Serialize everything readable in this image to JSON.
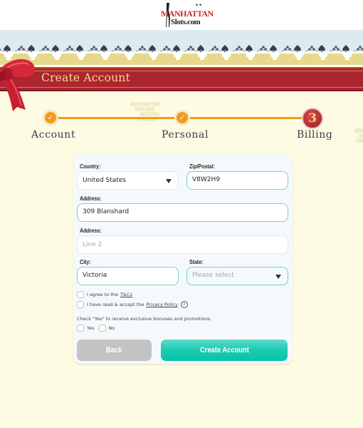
{
  "logo": {
    "line1": "MANHATTAN",
    "line2": "Slots.com"
  },
  "banner": {
    "title": "Create Account",
    "decoration": "ribbon-bow-icon"
  },
  "stepper": {
    "steps": [
      {
        "label": "Account",
        "status": "completed",
        "icon": "check-icon"
      },
      {
        "label": "Personal",
        "status": "completed",
        "icon": "check-icon"
      },
      {
        "label": "Billing",
        "status": "current",
        "number": "3"
      }
    ],
    "accent_color": "#f39a1c",
    "current_color": "#ac2530"
  },
  "form": {
    "country": {
      "label": "Country:",
      "value": "United States"
    },
    "zip": {
      "label": "Zip/Postal:",
      "value": "V8W2H9"
    },
    "address1": {
      "label": "Address:",
      "value": "309 Blanshard"
    },
    "address2": {
      "label": "Address:",
      "placeholder": "Line 2"
    },
    "city": {
      "label": "City:",
      "value": "Victoria"
    },
    "state": {
      "label": "State:",
      "placeholder": "Please select"
    },
    "terms": {
      "text": "I agree to the",
      "link": "T&Cs",
      "checked": false
    },
    "privacy": {
      "text": "I have read & accept the",
      "link": "Privacy Policy",
      "help": "?",
      "checked": false
    },
    "promo": {
      "text": "Check \"Yes\" to receive exclusive bonuses and promotions",
      "yes": "Yes",
      "no": "No"
    },
    "buttons": {
      "back": "Back",
      "create": "Create Account"
    },
    "active_border_color": "#6fd6c6",
    "primary_color": "#03c4a8"
  }
}
